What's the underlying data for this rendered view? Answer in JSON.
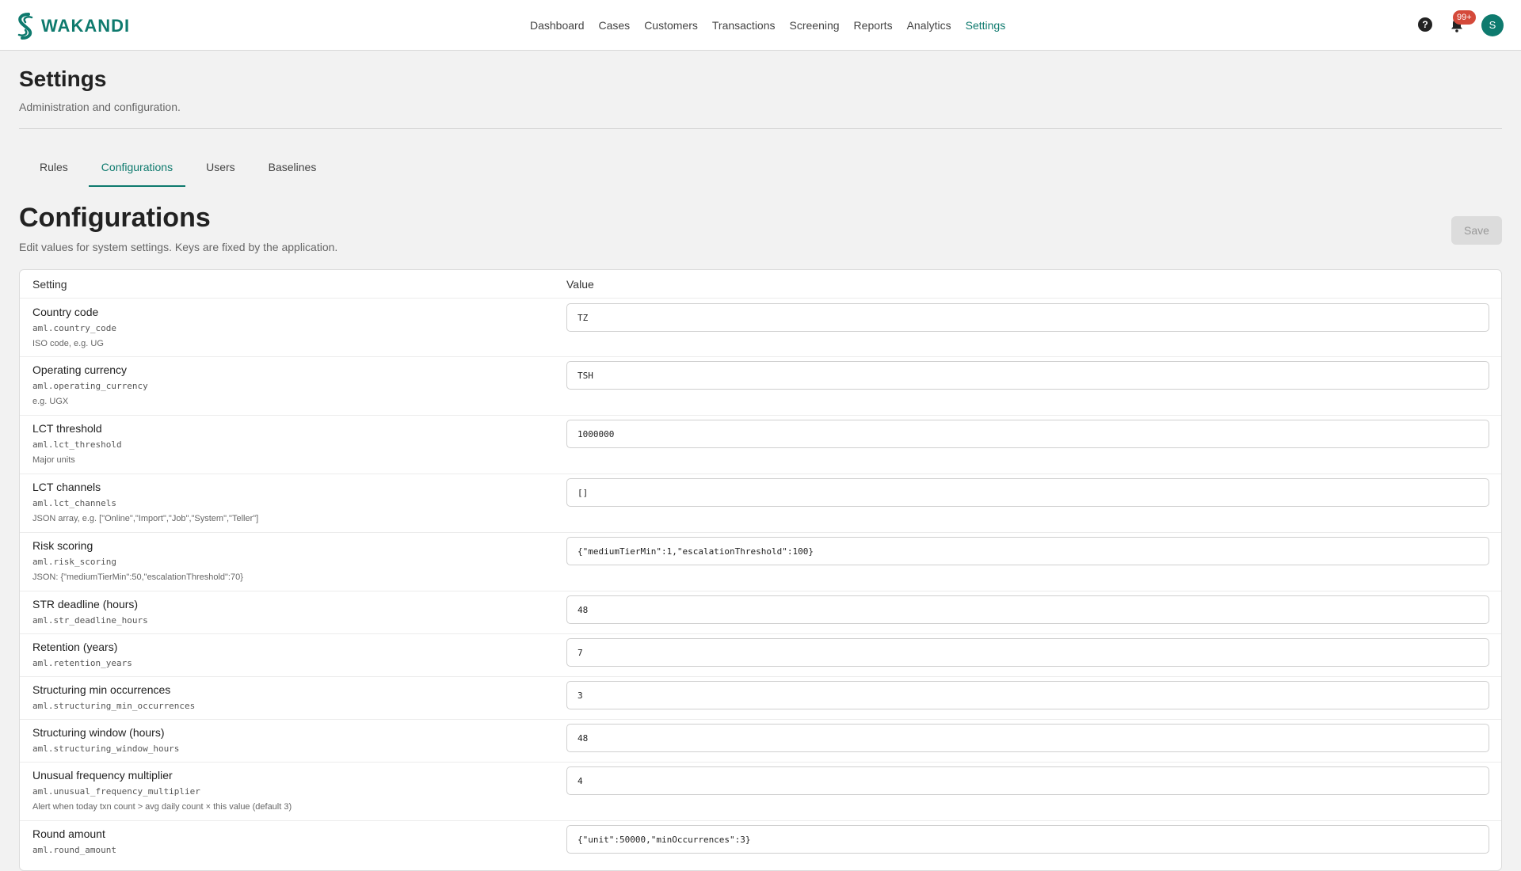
{
  "app": {
    "name": "WAKANDI"
  },
  "nav": [
    {
      "label": "Dashboard",
      "active": false
    },
    {
      "label": "Cases",
      "active": false
    },
    {
      "label": "Customers",
      "active": false
    },
    {
      "label": "Transactions",
      "active": false
    },
    {
      "label": "Screening",
      "active": false
    },
    {
      "label": "Reports",
      "active": false
    },
    {
      "label": "Analytics",
      "active": false
    },
    {
      "label": "Settings",
      "active": true
    }
  ],
  "header_right": {
    "help_icon": "?",
    "notification_count": "99+",
    "avatar_initial": "S"
  },
  "page": {
    "title": "Settings",
    "subtitle": "Administration and configuration."
  },
  "tabs": [
    {
      "label": "Rules",
      "active": false
    },
    {
      "label": "Configurations",
      "active": true
    },
    {
      "label": "Users",
      "active": false
    },
    {
      "label": "Baselines",
      "active": false
    }
  ],
  "section": {
    "title": "Configurations",
    "subtitle": "Edit values for system settings. Keys are fixed by the application.",
    "save_label": "Save"
  },
  "table": {
    "headers": {
      "setting": "Setting",
      "value": "Value"
    },
    "rows": [
      {
        "label": "Country code",
        "key": "aml.country_code",
        "hint": "ISO code, e.g. UG",
        "value": "TZ"
      },
      {
        "label": "Operating currency",
        "key": "aml.operating_currency",
        "hint": "e.g. UGX",
        "value": "TSH"
      },
      {
        "label": "LCT threshold",
        "key": "aml.lct_threshold",
        "hint": "Major units",
        "value": "1000000"
      },
      {
        "label": "LCT channels",
        "key": "aml.lct_channels",
        "hint": "JSON array, e.g. [\"Online\",\"Import\",\"Job\",\"System\",\"Teller\"]",
        "value": "[]"
      },
      {
        "label": "Risk scoring",
        "key": "aml.risk_scoring",
        "hint": "JSON: {\"mediumTierMin\":50,\"escalationThreshold\":70}",
        "value": "{\"mediumTierMin\":1,\"escalationThreshold\":100}"
      },
      {
        "label": "STR deadline (hours)",
        "key": "aml.str_deadline_hours",
        "hint": "",
        "value": "48"
      },
      {
        "label": "Retention (years)",
        "key": "aml.retention_years",
        "hint": "",
        "value": "7"
      },
      {
        "label": "Structuring min occurrences",
        "key": "aml.structuring_min_occurrences",
        "hint": "",
        "value": "3"
      },
      {
        "label": "Structuring window (hours)",
        "key": "aml.structuring_window_hours",
        "hint": "",
        "value": "48"
      },
      {
        "label": "Unusual frequency multiplier",
        "key": "aml.unusual_frequency_multiplier",
        "hint": "Alert when today txn count > avg daily count × this value (default 3)",
        "value": "4"
      },
      {
        "label": "Round amount",
        "key": "aml.round_amount",
        "hint": "",
        "value": "{\"unit\":50000,\"minOccurrences\":3}"
      }
    ]
  },
  "colors": {
    "brand": "#0e7a6e",
    "badge": "#d4493a"
  }
}
